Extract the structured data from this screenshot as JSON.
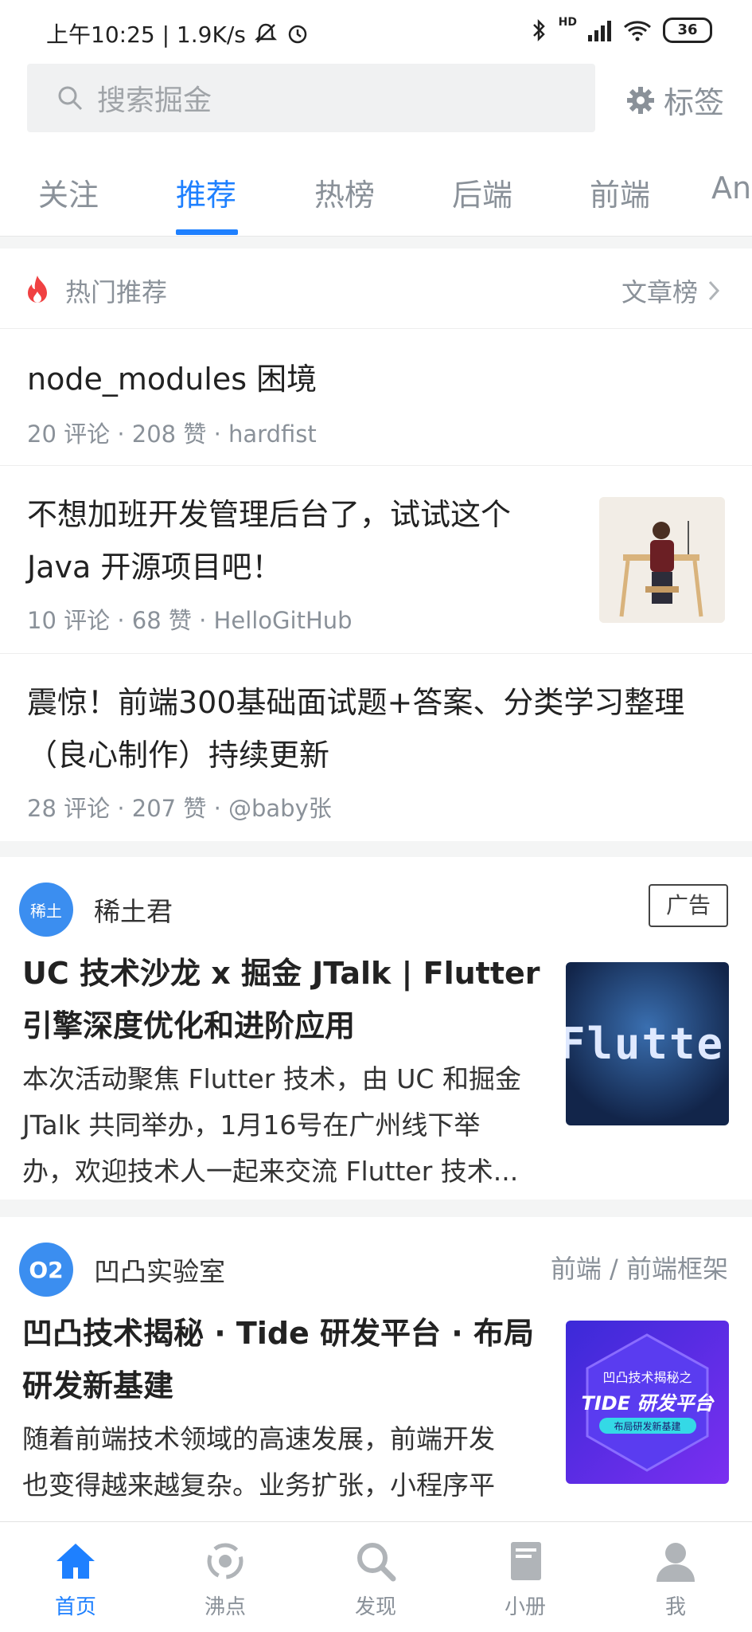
{
  "status": {
    "time": "上午10:25 | 1.9K/s",
    "battery": "36",
    "signal_label": "HD"
  },
  "search": {
    "placeholder": "搜索掘金",
    "tag_label": "标签"
  },
  "tabs": [
    "关注",
    "推荐",
    "热榜",
    "后端",
    "前端",
    "Android"
  ],
  "active_tab": "推荐",
  "hot": {
    "title": "热门推荐",
    "rank_link": "文章榜",
    "items": [
      {
        "title": "node_modules 困境",
        "meta": "20 评论 · 208 赞 · hardfist"
      },
      {
        "title_line1": "不想加班开发管理后台了，试试这个",
        "title_line2": "Java 开源项目吧！",
        "meta": "10 评论 · 68 赞 · HelloGitHub"
      },
      {
        "title_line1": "震惊！前端300基础面试题+答案、分类学习整理",
        "title_line2": "（良心制作）持续更新",
        "meta": "28 评论 · 207 赞 · @baby张"
      }
    ]
  },
  "cards": [
    {
      "author": "稀土君",
      "avatar_text": "稀土",
      "badge": "广告",
      "title_line1": "UC 技术沙龙 x 掘金 JTalk | Flutter",
      "title_line2": "引擎深度优化和进阶应用",
      "desc_line1": "本次活动聚焦 Flutter 技术，由 UC 和掘金",
      "desc_line2": "JTalk 共同举办，1月16号在广州线下举",
      "desc_line3": "办，欢迎技术人一起来交流 Flutter 技术...",
      "thumb_text": "Flutte"
    },
    {
      "author": "凹凸实验室",
      "avatar_text": "O2",
      "category": "前端 / 前端框架",
      "title_line1": "凹凸技术揭秘 · Tide 研发平台 · 布局",
      "title_line2": "研发新基建",
      "desc_line1": "随着前端技术领域的高速发展，前端开发",
      "desc_line2": "也变得越来越复杂。业务扩张，小程序平",
      "thumb_line1": "凹凸技术揭秘之",
      "thumb_line2": "TIDE 研发平台",
      "thumb_line3": "布局研发新基建"
    }
  ],
  "nav": [
    "首页",
    "沸点",
    "发现",
    "小册",
    "我"
  ],
  "colors": {
    "accent": "#1e80ff",
    "muted": "#8a9199",
    "fire": "#f04142"
  }
}
